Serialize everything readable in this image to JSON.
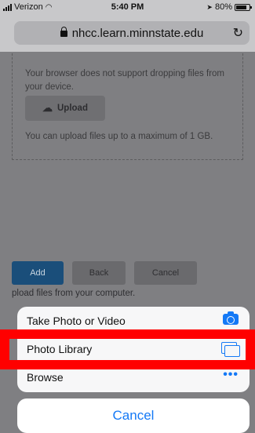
{
  "status_bar": {
    "carrier": "Verizon",
    "time": "5:40 PM",
    "battery": "80%",
    "battery_level": 0.8
  },
  "browser": {
    "url": "nhcc.learn.minnstate.edu"
  },
  "page": {
    "drop_message": "Your browser does not support dropping files from your device.",
    "upload_label": "Upload",
    "limit_message": "You can upload files up to a maximum of 1 GB.",
    "add_label": "Add",
    "back_label": "Back",
    "cancel_label": "Cancel",
    "hint": "pload files from your computer."
  },
  "action_sheet": {
    "options": [
      {
        "label": "Take Photo or Video",
        "icon": "camera-icon"
      },
      {
        "label": "Photo Library",
        "icon": "photo-library-icon"
      },
      {
        "label": "Browse",
        "icon": "more-dots-icon"
      }
    ],
    "cancel_label": "Cancel"
  },
  "colors": {
    "accent": "#1479f6",
    "highlight": "#ff0000",
    "add_button": "#1a4e7a"
  }
}
